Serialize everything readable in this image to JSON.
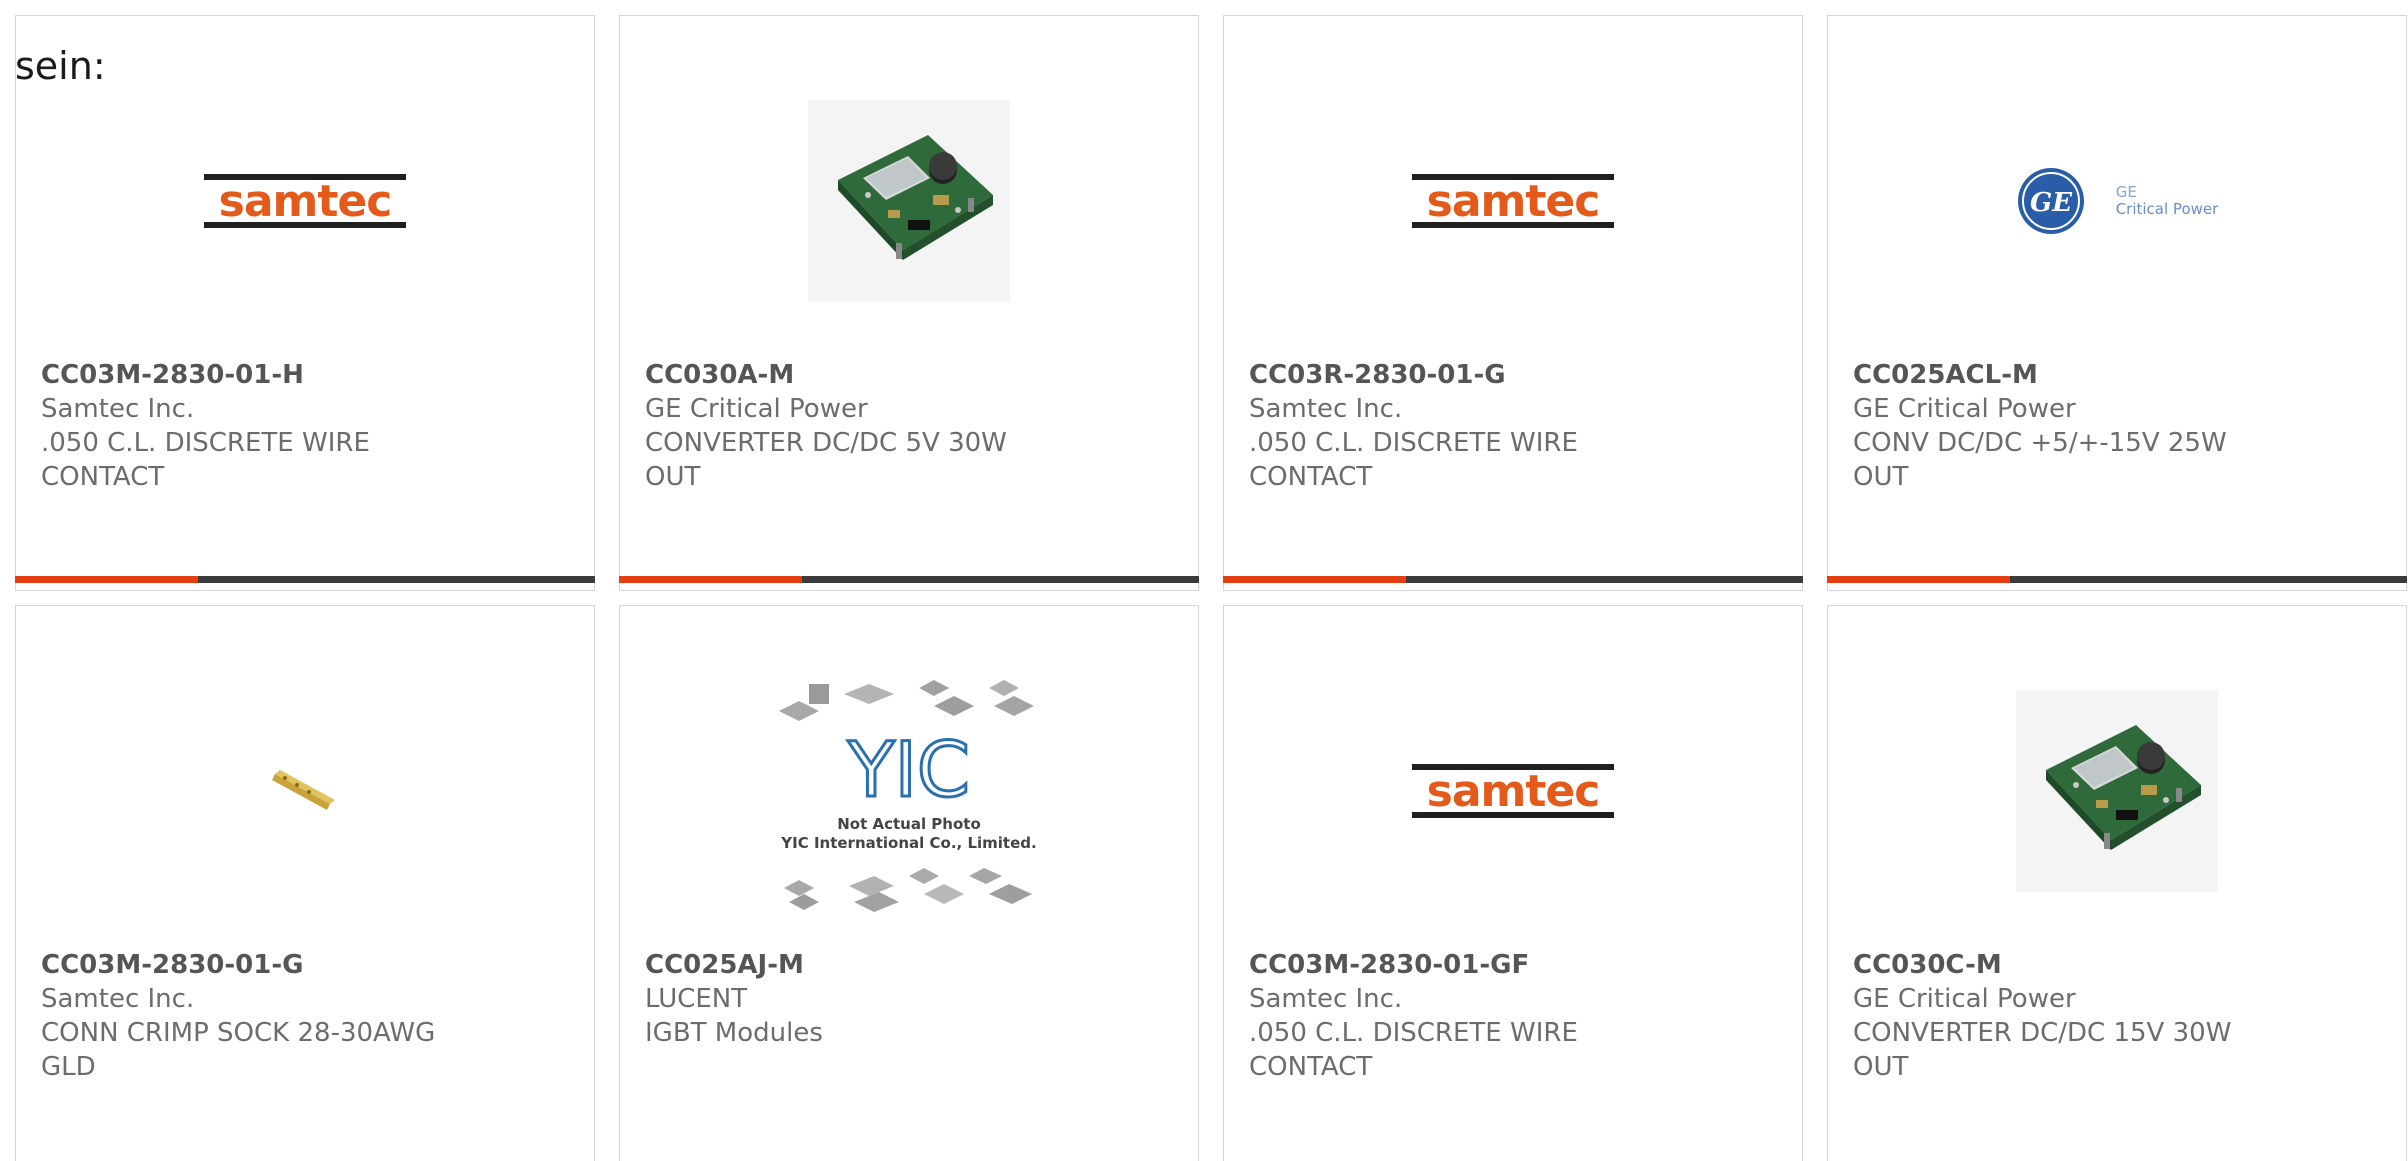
{
  "intro_text": "sein:",
  "colors": {
    "accent_bar": "#e43f12",
    "bar": "#3b3b3b",
    "samtec_orange": "#e45a1a",
    "ge_blue": "#2a5da8"
  },
  "products": [
    {
      "part": "CC03M-2830-01-H",
      "manufacturer": "Samtec Inc.",
      "description": ".050 C.L. DISCRETE WIRE CONTACT",
      "image": "samtec-logo"
    },
    {
      "part": "CC030A-M",
      "manufacturer": "GE Critical Power",
      "description": "CONVERTER DC/DC 5V 30W OUT",
      "image": "pcb-module-photo"
    },
    {
      "part": "CC03R-2830-01-G",
      "manufacturer": "Samtec Inc.",
      "description": ".050 C.L. DISCRETE WIRE CONTACT",
      "image": "samtec-logo"
    },
    {
      "part": "CC025ACL-M",
      "manufacturer": "GE Critical Power",
      "description": "CONV DC/DC +5/+-15V 25W OUT",
      "image": "ge-logo"
    },
    {
      "part": "CC03M-2830-01-G",
      "manufacturer": "Samtec Inc.",
      "description": "CONN CRIMP SOCK 28-30AWG GLD",
      "image": "crimp-contact-photo"
    },
    {
      "part": "CC025AJ-M",
      "manufacturer": "LUCENT",
      "description": "IGBT Modules",
      "image": "yic-placeholder"
    },
    {
      "part": "CC03M-2830-01-GF",
      "manufacturer": "Samtec Inc.",
      "description": ".050 C.L. DISCRETE WIRE CONTACT",
      "image": "samtec-logo"
    },
    {
      "part": "CC030C-M",
      "manufacturer": "GE Critical Power",
      "description": "CONVERTER DC/DC 15V 30W OUT",
      "image": "pcb-module-photo"
    }
  ],
  "logos": {
    "samtec_word": "samtec",
    "ge_monogram": "GE",
    "ge_line1": "GE",
    "ge_line2": "Critical Power",
    "yic_mark": "YIC",
    "yic_caption1": "Not Actual Photo",
    "yic_caption2": "YIC International Co., Limited."
  }
}
